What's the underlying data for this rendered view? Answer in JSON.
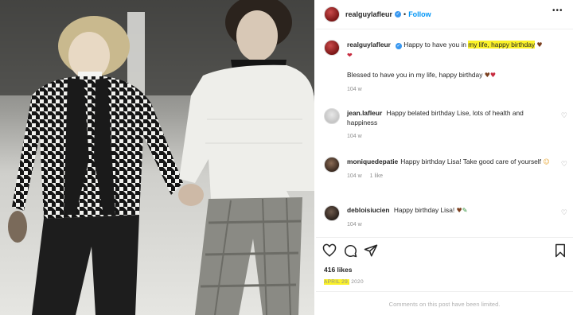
{
  "post": {
    "username": "realguylafleur",
    "follow_label": "Follow",
    "separator": "•",
    "more_label": "•••"
  },
  "caption": {
    "username": "realguylafleur",
    "text_pre": "Happy to have you in ",
    "text_highlight": "my life, happy birthday",
    "emoji_after_highlight": "❤",
    "emoji_line_start": "♥",
    "second_line": "Blessed to have you in my life, happy birthday",
    "second_line_emojis": "♥♥",
    "time": "104 w"
  },
  "comments": [
    {
      "username": "jean.lafleur",
      "text": "Happy belated birthday Lise, lots of health and happiness",
      "time": "104 w",
      "likes": "",
      "reply": ""
    },
    {
      "username": "moniquedepatie",
      "text": "Happy birthday Lisa! Take good care of yourself",
      "emoji": "☺",
      "time": "104 w",
      "likes": "1 like"
    },
    {
      "username": "debloisiucien",
      "text": "Happy birthday Lisa!",
      "emoji": "♥",
      "emoji2": "✎",
      "time": "104 w"
    }
  ],
  "stats": {
    "likes": "416 likes",
    "date_highlight": "APRIL 29,",
    "date_rest": " 2020"
  },
  "footer": {
    "limited_text": "Comments on this post have been limited."
  },
  "icons": {
    "like": "heart-icon",
    "comment": "comment-icon",
    "share": "paper-plane-icon",
    "save": "bookmark-icon"
  },
  "colors": {
    "highlight": "#fbf229",
    "follow": "#0095f6",
    "verified": "#3897f0",
    "muted": "#8e8e8e"
  }
}
